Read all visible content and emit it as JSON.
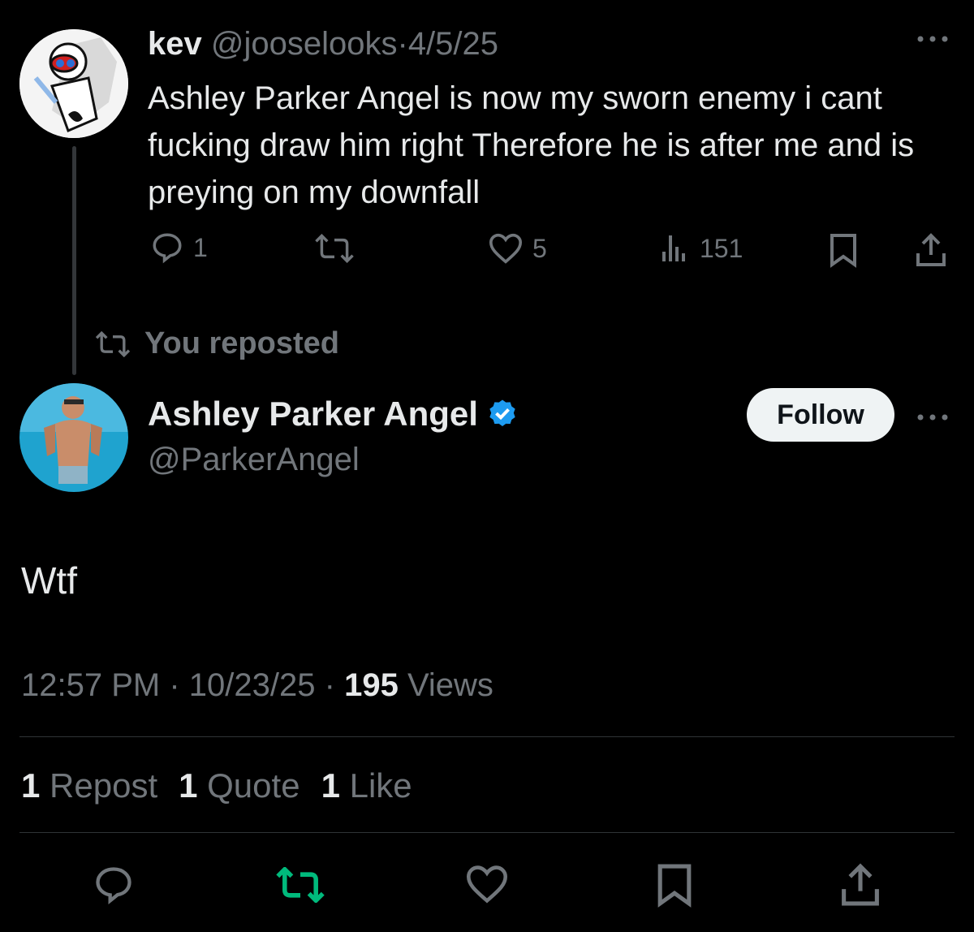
{
  "quoted": {
    "display_name": "kev",
    "handle": "@jooselooks",
    "date": "4/5/25",
    "separator": "·",
    "text": "Ashley Parker Angel is now my sworn enemy i cant fucking draw him right Therefore he is after me and is preying on my downfall",
    "actions": {
      "replies": "1",
      "reposts": "",
      "likes": "5",
      "views": "151"
    }
  },
  "repost_banner": {
    "label": "You reposted"
  },
  "main": {
    "display_name": "Ashley Parker Angel",
    "handle": "@ParkerAngel",
    "verified": true,
    "follow_label": "Follow",
    "text": "Wtf",
    "time": "12:57 PM",
    "date": "10/23/25",
    "separator": "·",
    "views_count": "195",
    "views_label": "Views",
    "stats": {
      "reposts_count": "1",
      "reposts_label": "Repost",
      "quotes_count": "1",
      "quotes_label": "Quote",
      "likes_count": "1",
      "likes_label": "Like"
    }
  },
  "colors": {
    "background": "#000000",
    "text": "#e7e9ea",
    "muted": "#71767b",
    "verified_blue": "#1d9bf0",
    "repost_active": "#00ba7c",
    "divider": "#2f3336"
  }
}
